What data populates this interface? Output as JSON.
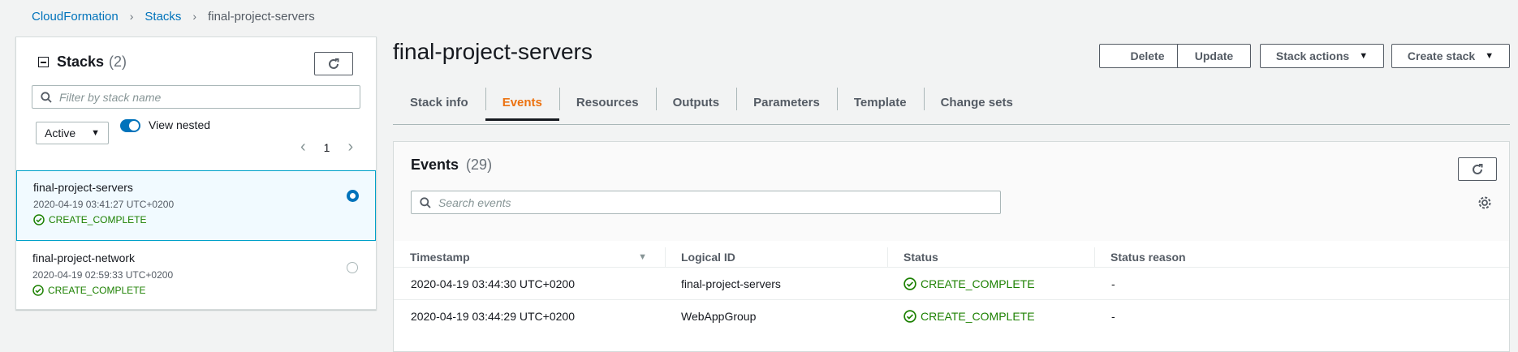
{
  "breadcrumb": {
    "root": "CloudFormation",
    "section": "Stacks",
    "current": "final-project-servers"
  },
  "stacks_panel": {
    "title": "Stacks",
    "count": "(2)",
    "filter_placeholder": "Filter by stack name",
    "status_filter": "Active",
    "view_nested_label": "View nested",
    "page": "1",
    "items": [
      {
        "name": "final-project-servers",
        "date": "2020-04-19 03:41:27 UTC+0200",
        "status": "CREATE_COMPLETE",
        "selected": true
      },
      {
        "name": "final-project-network",
        "date": "2020-04-19 02:59:33 UTC+0200",
        "status": "CREATE_COMPLETE",
        "selected": false
      }
    ]
  },
  "main": {
    "title": "final-project-servers",
    "buttons": {
      "delete": "Delete",
      "update": "Update",
      "stack_actions": "Stack actions",
      "create_stack": "Create stack"
    },
    "tabs": [
      "Stack info",
      "Events",
      "Resources",
      "Outputs",
      "Parameters",
      "Template",
      "Change sets"
    ],
    "active_tab": "Events"
  },
  "events": {
    "title": "Events",
    "count": "(29)",
    "search_placeholder": "Search events",
    "columns": [
      "Timestamp",
      "Logical ID",
      "Status",
      "Status reason"
    ],
    "rows": [
      {
        "timestamp": "2020-04-19 03:44:30 UTC+0200",
        "logical_id": "final-project-servers",
        "status": "CREATE_COMPLETE",
        "reason": "-"
      },
      {
        "timestamp": "2020-04-19 03:44:29 UTC+0200",
        "logical_id": "WebAppGroup",
        "status": "CREATE_COMPLETE",
        "reason": "-"
      }
    ]
  },
  "colors": {
    "link": "#0073bb",
    "success": "#1d8102",
    "active_tab": "#ec7211"
  }
}
